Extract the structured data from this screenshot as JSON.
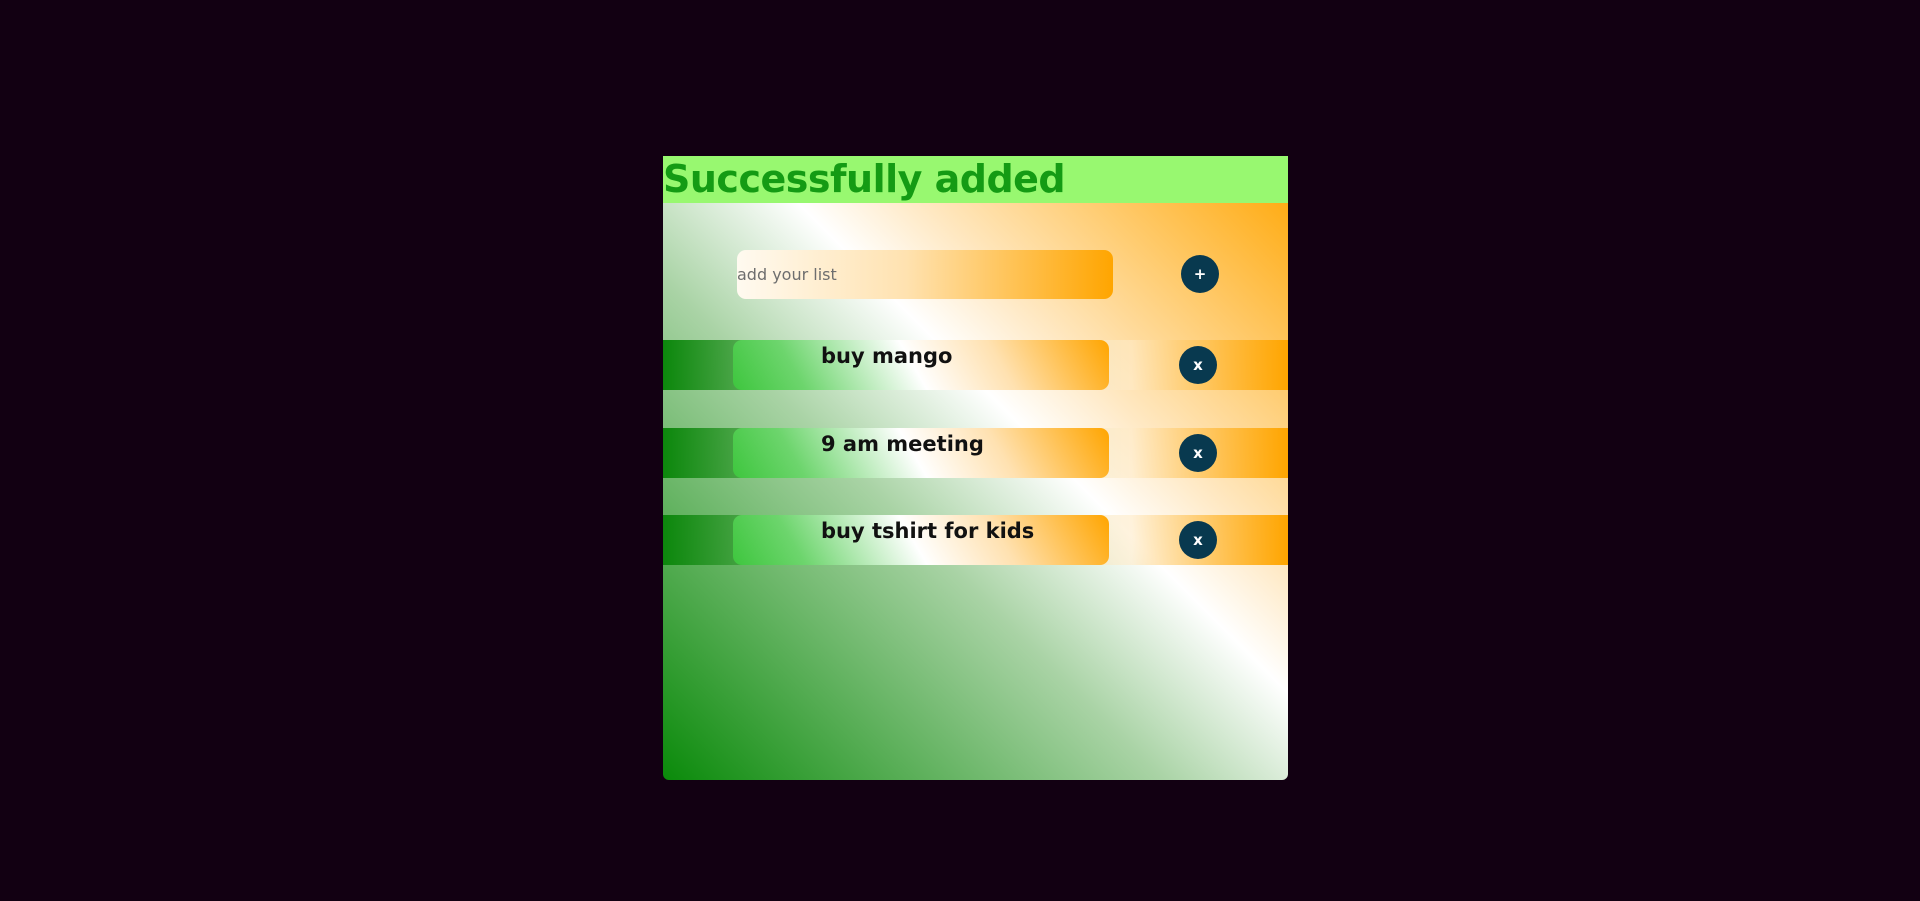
{
  "toast": {
    "message": "Successfully added"
  },
  "add_form": {
    "input_value": "",
    "placeholder": "add your list",
    "add_label": "+"
  },
  "todos": [
    {
      "text": "buy mango",
      "delete_label": "x"
    },
    {
      "text": "9 am meeting",
      "delete_label": "x"
    },
    {
      "text": "buy tshirt for kids",
      "delete_label": "x"
    }
  ],
  "colors": {
    "page_background": "#120012",
    "toast_background": "#98f870",
    "toast_text": "#149b14",
    "button_background": "#08394f",
    "accent_orange": "#ffa500",
    "accent_green": "#0a8a0a"
  }
}
